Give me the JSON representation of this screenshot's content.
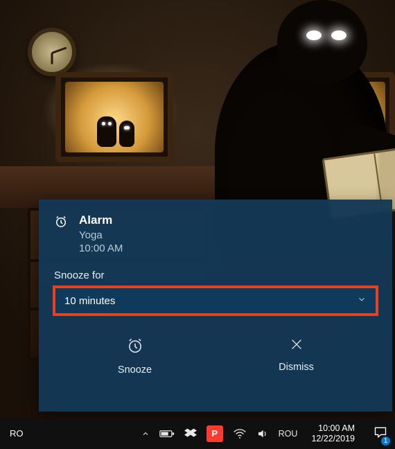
{
  "toast": {
    "app": "Alarm",
    "title": "Yoga",
    "time": "10:00 AM",
    "snooze_label": "Snooze for",
    "snooze_value": "10 minutes",
    "actions": {
      "snooze": "Snooze",
      "dismiss": "Dismiss"
    }
  },
  "taskbar": {
    "language_display": "RO",
    "ime": "ROU",
    "clock_time": "10:00 AM",
    "clock_date": "12/22/2019",
    "notification_count": "1"
  }
}
